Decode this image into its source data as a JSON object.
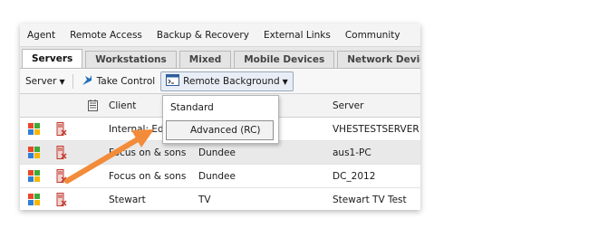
{
  "topnav": [
    "Agent",
    "Remote Access",
    "Backup & Recovery",
    "External Links",
    "Community"
  ],
  "tabs": [
    "Servers",
    "Workstations",
    "Mixed",
    "Mobile Devices",
    "Network Devices"
  ],
  "toolbar": {
    "server_label": "Server",
    "take_control_label": "Take Control",
    "remote_background_label": "Remote Background"
  },
  "table": {
    "headers": {
      "client": "Client",
      "server": "Server"
    },
    "rows": [
      {
        "client": "Internal: Ed",
        "site": "",
        "server": "VHESTESTSERVER"
      },
      {
        "client": "Focus on & sons",
        "site": "Dundee",
        "server": "aus1-PC"
      },
      {
        "client": "Focus on & sons",
        "site": "Dundee",
        "server": "DC_2012"
      },
      {
        "client": "Stewart",
        "site": "TV",
        "server": "Stewart TV Test"
      }
    ]
  },
  "dropdown": {
    "items": [
      "Standard",
      "Advanced (RC)"
    ],
    "highlighted": "Advanced (RC)"
  },
  "colors": {
    "arrow": "#f28c3a",
    "win_red": "#e8472a",
    "win_green": "#3faa35",
    "win_blue": "#2f7fd6",
    "win_yellow": "#f7b500"
  },
  "icons": {
    "server_status": "server-alert-icon",
    "take_control": "take-control-icon",
    "remote_background": "terminal-window-icon",
    "notes_column": "notes-icon"
  }
}
